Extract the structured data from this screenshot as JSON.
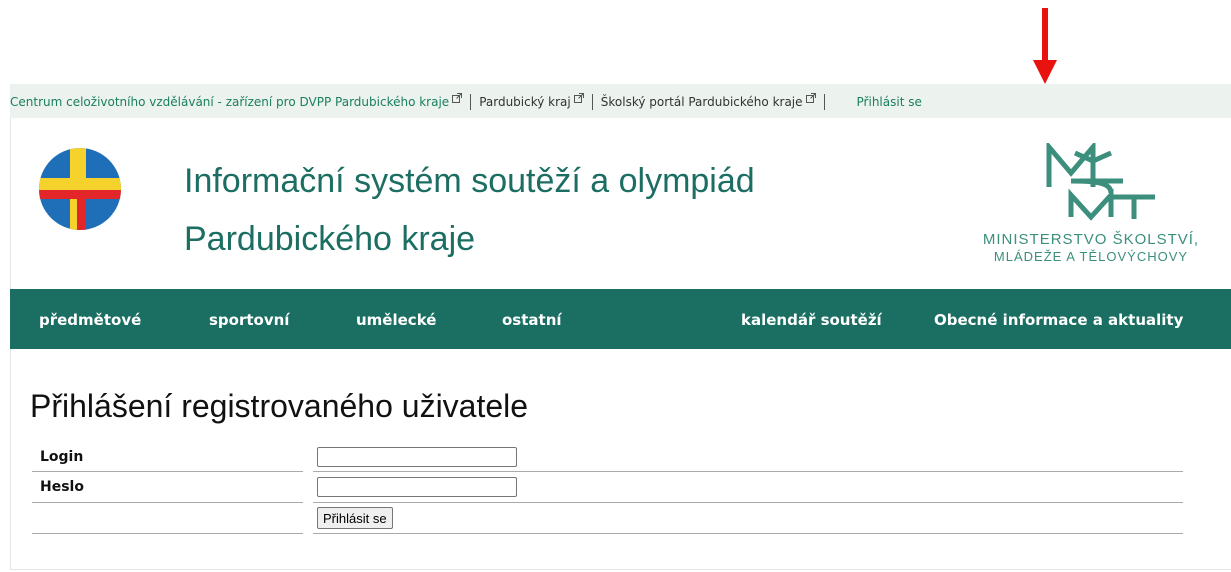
{
  "topbar": {
    "links": [
      {
        "label": "Centrum celoživotního vzdělávání - zařízení pro DVPP Pardubického kraje"
      },
      {
        "label": "Pardubický kraj"
      },
      {
        "label": "Školský portál Pardubického kraje"
      }
    ],
    "login_link": "Přihlásit se"
  },
  "header": {
    "title_line1": "Informační systém soutěží a olympiád",
    "title_line2": "Pardubického kraje",
    "ministry_line1": "MINISTERSTVO ŠKOLSTVÍ,",
    "ministry_line2": "MLÁDEŽE A TĚLOVÝCHOVY",
    "ministry_logo_letters": "MŠMT"
  },
  "nav": {
    "items": [
      "předmětové",
      "sportovní",
      "umělecké",
      "ostatní",
      "kalendář soutěží",
      "Obecné informace a aktuality"
    ]
  },
  "main": {
    "heading": "Přihlášení registrovaného uživatele",
    "login_label": "Login",
    "login_value": "",
    "password_label": "Heslo",
    "password_value": "",
    "submit_label": "Přihlásit se"
  },
  "colors": {
    "accent": "#1a6e62",
    "link_green": "#1a7f5f",
    "annotation_arrow": "#e8130e"
  },
  "icons": [
    "external-link-icon",
    "annotation-arrow-icon",
    "region-logo-icon",
    "msmt-logo-icon"
  ]
}
